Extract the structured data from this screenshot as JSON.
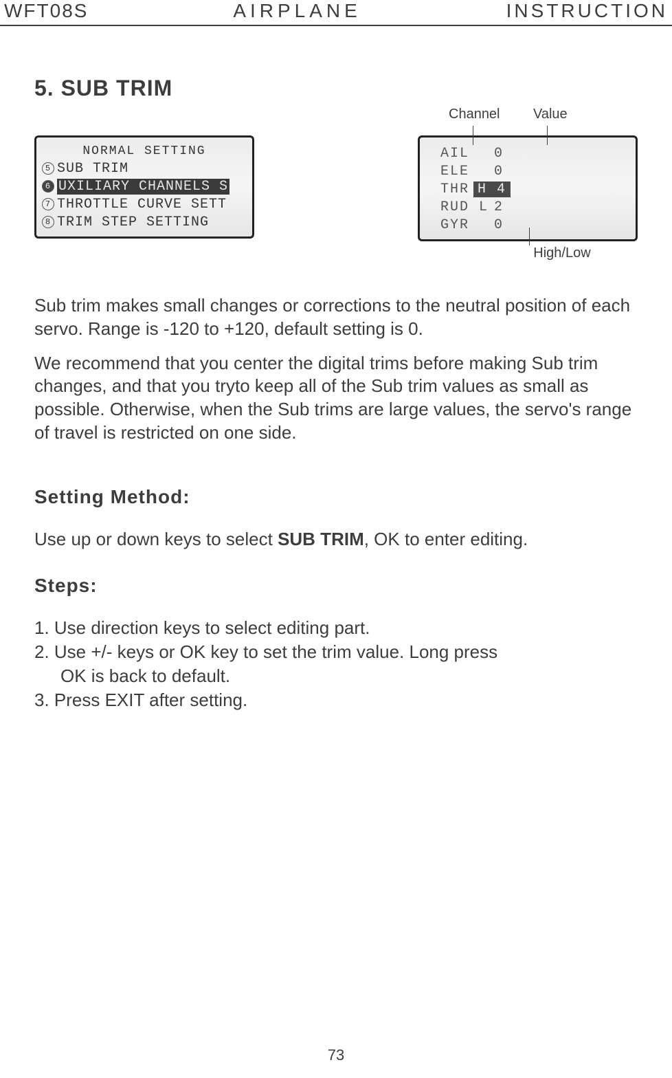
{
  "header": {
    "left": "WFT08S",
    "center": "AIRPLANE",
    "right": "INSTRUCTION"
  },
  "section_title": "5. SUB TRIM",
  "callouts": {
    "channel": "Channel",
    "value": "Value",
    "highlow": "High/Low"
  },
  "lcd_left": {
    "title": "NORMAL SETTING",
    "rows": [
      {
        "num": "5",
        "text": "SUB TRIM",
        "selected": false
      },
      {
        "num": "6",
        "text": "UXILIARY CHANNELS S",
        "selected": true
      },
      {
        "num": "7",
        "text": "THROTTLE CURVE SETT",
        "selected": false
      },
      {
        "num": "8",
        "text": "TRIM STEP SETTING",
        "selected": false
      }
    ]
  },
  "lcd_right": {
    "rows": [
      {
        "ch": "AIL",
        "hl": "",
        "val": "0",
        "selected": false
      },
      {
        "ch": "ELE",
        "hl": "",
        "val": "0",
        "selected": false
      },
      {
        "ch": "THR",
        "hl": "H",
        "val": "4",
        "selected": true
      },
      {
        "ch": "RUD",
        "hl": "L",
        "val": "2",
        "selected": false
      },
      {
        "ch": "GYR",
        "hl": "",
        "val": "0",
        "selected": false
      }
    ]
  },
  "para1": "Sub trim makes small changes or corrections to the neutral position of each servo. Range is -120 to +120, default setting is 0.",
  "para2": "We recommend that you center the digital trims before making Sub trim changes, and that you tryto keep all of the Sub trim values as small as possible. Otherwise, when the Sub trims are large values, the servo's range of travel is restricted on one side.",
  "setting_method_head": "Setting Method:",
  "setting_method_line_pre": "Use up or down keys to select ",
  "setting_method_bold": "SUB TRIM",
  "setting_method_line_post": ", OK to enter editing.",
  "steps_head": "Steps:",
  "steps": {
    "s1": "1. Use direction keys to select editing part.",
    "s2a": "2. Use +/- keys or OK key to set the trim value. Long press",
    "s2b": "OK is back to default.",
    "s3": "3. Press EXIT after setting."
  },
  "page_number": "73"
}
